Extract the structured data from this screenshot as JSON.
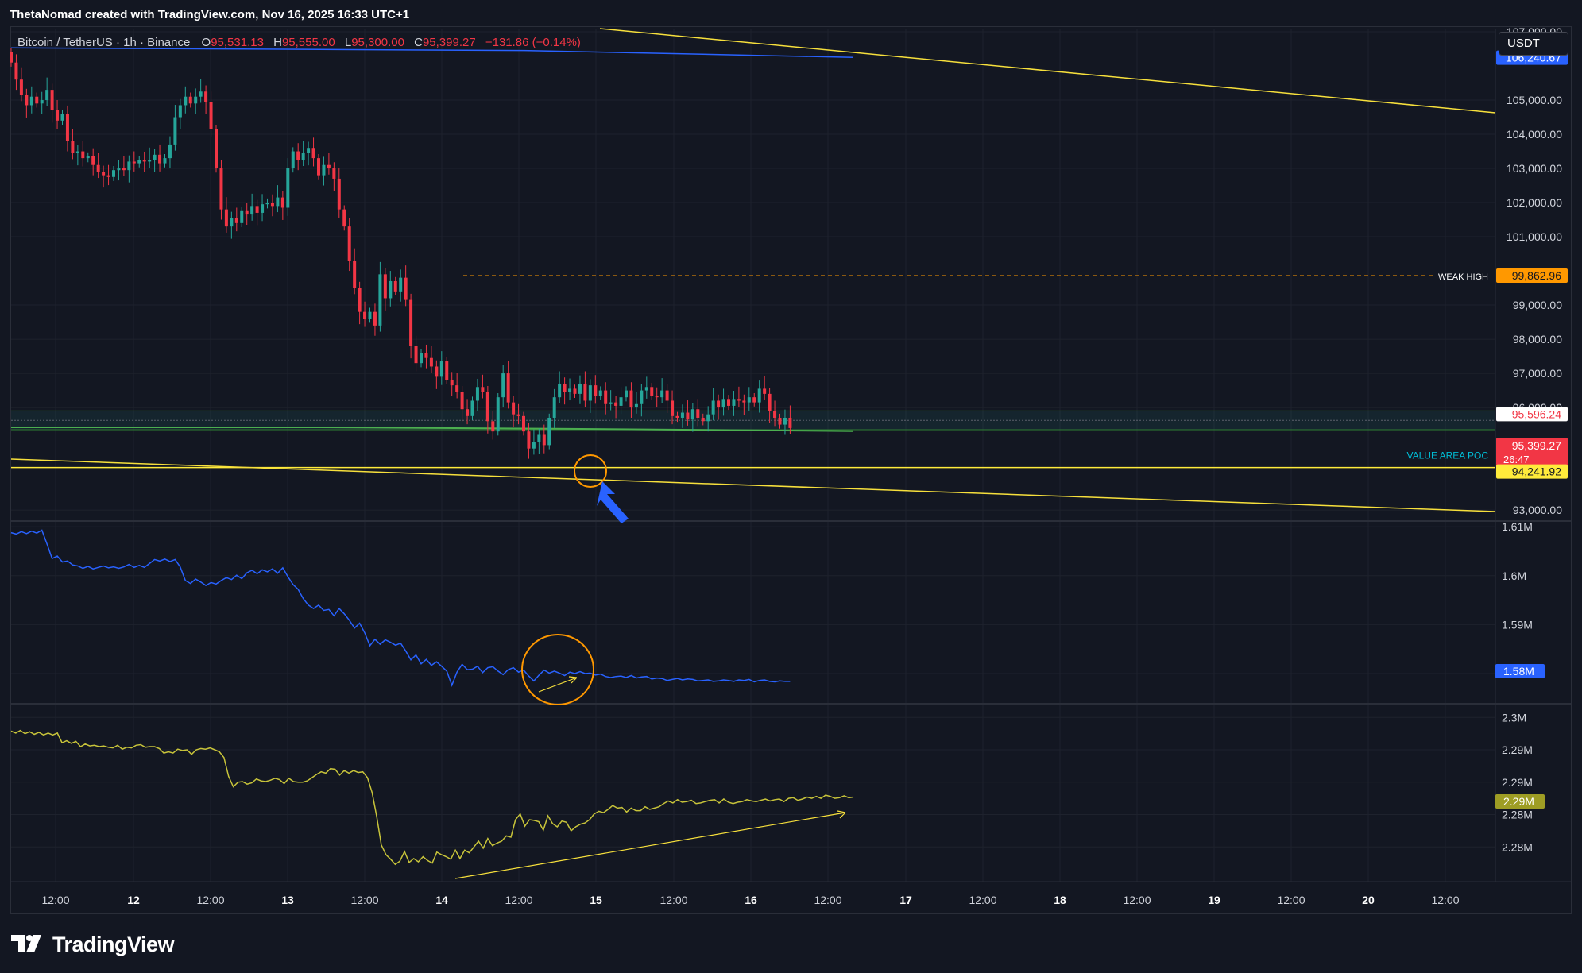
{
  "header": {
    "attribution": "ThetaNomad created with TradingView.com, Nov 16, 2025 16:33 UTC+1"
  },
  "symbol": {
    "name": "Bitcoin / TetherUS · 1h · Binance",
    "open_key": "O",
    "open": "95,531.13",
    "high_key": "H",
    "high": "95,555.00",
    "low_key": "L",
    "low": "95,300.00",
    "close_key": "C",
    "close": "95,399.27",
    "change": "−131.86 (−0.14%)"
  },
  "currency": "USDT",
  "logo": {
    "text": "TradingView"
  },
  "colors": {
    "background": "#131722",
    "grid": "#1e222d",
    "up": "#26a69a",
    "down": "#f23645",
    "trendline": "#f7e03c",
    "blue_line": "#2962ff",
    "weak_high": "#ff9800",
    "poc": "#ffeb3b",
    "cvd": "#2962ff",
    "obv": "#c8c43a",
    "annotation_orange": "#ff9800",
    "arrow_blue": "#2962ff"
  },
  "chart_data": [
    {
      "type": "candlestick",
      "pane": "price",
      "ylim": [
        92700,
        107000
      ],
      "y_ticks": [
        "107,000.00",
        "105,000.00",
        "104,000.00",
        "103,000.00",
        "102,000.00",
        "101,000.00",
        "99,000.00",
        "98,000.00",
        "97,000.00",
        "96,000.00",
        "93,000.00"
      ],
      "x_ticks": [
        "12:00",
        "12",
        "12:00",
        "13",
        "12:00",
        "14",
        "12:00",
        "15",
        "12:00",
        "16",
        "12:00",
        "17",
        "12:00",
        "18",
        "12:00",
        "19",
        "12:00",
        "20",
        "12:00"
      ],
      "close": [
        106100,
        105600,
        105150,
        104850,
        105100,
        104900,
        105000,
        105300,
        104700,
        104400,
        104600,
        103800,
        103450,
        103500,
        103300,
        103350,
        103100,
        102900,
        102800,
        102750,
        102950,
        103000,
        102950,
        103200,
        103150,
        103250,
        103200,
        103250,
        103400,
        103150,
        103300,
        103700,
        104500,
        104850,
        105100,
        104900,
        105100,
        105250,
        104950,
        104150,
        103000,
        101800,
        101300,
        101550,
        101400,
        101750,
        101650,
        101900,
        101700,
        101950,
        102000,
        101900,
        102150,
        101850,
        103000,
        103500,
        103250,
        103450,
        103600,
        103300,
        102800,
        103100,
        103000,
        102700,
        101800,
        101300,
        100300,
        99500,
        98800,
        98600,
        98800,
        98400,
        99900,
        99200,
        99700,
        99400,
        99800,
        99150,
        97800,
        97300,
        97600,
        97450,
        97200,
        96900,
        97350,
        96800,
        96650,
        96450,
        95950,
        95750,
        96200,
        96600,
        96450,
        95600,
        95300,
        96300,
        97000,
        96150,
        95800,
        95750,
        95300,
        94800,
        95000,
        95200,
        94900,
        95700,
        96300,
        96700,
        96450,
        96550,
        96400,
        96700,
        96200,
        96650,
        96350,
        96500,
        96100,
        96150,
        96050,
        96300,
        96500,
        96000,
        96100,
        96500,
        96600,
        96350,
        96300,
        96500,
        96200,
        95750,
        95700,
        95850,
        95650,
        95950,
        95700,
        95600,
        95800,
        96200,
        96000,
        96250,
        96050,
        96250,
        96200,
        96150,
        96300,
        96150,
        96550,
        96400,
        95900,
        95700,
        95500,
        95700,
        95399.27
      ],
      "indicators": {
        "value_area_poc_label": "VALUE AREA POC",
        "value_area_poc_price": "94,241.92",
        "weak_high_label": "WEAK HIGH",
        "weak_high_price": "99,862.96",
        "blue_line_price": "106,240.67",
        "band_top_price": "95,596.24",
        "last_price": "95,399.27",
        "countdown": "26:47",
        "band_low": 95350,
        "band_high": 95900
      }
    },
    {
      "type": "line",
      "pane": "cvd",
      "ylim": [
        1574000,
        1611000
      ],
      "y_ticks": [
        "1.61M",
        "1.6M",
        "1.59M",
        "1.58M"
      ],
      "last_label": "1.58M",
      "values": [
        1608800,
        1608500,
        1609000,
        1608600,
        1609100,
        1608700,
        1609300,
        1606500,
        1603500,
        1604000,
        1602800,
        1603000,
        1602200,
        1602000,
        1601500,
        1601900,
        1601400,
        1601700,
        1602000,
        1601600,
        1601800,
        1601500,
        1601800,
        1602300,
        1601700,
        1602100,
        1601700,
        1602500,
        1603300,
        1603000,
        1603400,
        1602900,
        1603300,
        1601800,
        1599000,
        1598400,
        1599300,
        1598700,
        1598000,
        1598600,
        1598300,
        1599000,
        1599600,
        1599200,
        1600100,
        1599400,
        1600600,
        1601100,
        1600400,
        1601200,
        1600800,
        1601400,
        1600500,
        1601600,
        1599800,
        1598200,
        1597200,
        1595300,
        1594000,
        1593300,
        1594000,
        1592900,
        1593100,
        1591800,
        1593300,
        1592200,
        1590900,
        1589300,
        1590300,
        1588300,
        1585700,
        1587000,
        1586000,
        1586900,
        1586400,
        1585800,
        1586200,
        1584600,
        1582800,
        1583800,
        1582000,
        1582900,
        1581700,
        1582400,
        1581500,
        1580500,
        1577600,
        1580300,
        1581900,
        1580800,
        1580900,
        1581500,
        1580200,
        1581200,
        1581400,
        1580500,
        1579800,
        1580800,
        1581200,
        1580300,
        1580700,
        1579500,
        1578500,
        1579700,
        1580700,
        1580100,
        1580500,
        1580100,
        1579600,
        1580300,
        1580000,
        1580400,
        1580000,
        1580100,
        1579700,
        1579900,
        1579400,
        1579200,
        1579400,
        1579500,
        1579200,
        1579600,
        1579100,
        1579300,
        1579400,
        1578900,
        1579100,
        1579000,
        1578600,
        1578800,
        1579000,
        1578700,
        1578900,
        1578800,
        1578500,
        1578600,
        1578700,
        1578400,
        1578500,
        1578700,
        1578600,
        1578400,
        1578700,
        1578600,
        1578800,
        1578300,
        1578600,
        1578700,
        1578400,
        1578300,
        1578500,
        1578400,
        1578400
      ]
    },
    {
      "type": "line",
      "pane": "obv",
      "ylim": [
        2275000,
        2302000
      ],
      "y_ticks": [
        "2.3M",
        "2.29M",
        "2.29M",
        "2.28M",
        "2.28M"
      ],
      "last_label": "2.29M",
      "values": [
        2297900,
        2297600,
        2298000,
        2297500,
        2297800,
        2297400,
        2297700,
        2297300,
        2297600,
        2297300,
        2297600,
        2296100,
        2296400,
        2296000,
        2296300,
        2295500,
        2295900,
        2295600,
        2295700,
        2295500,
        2295600,
        2295400,
        2295300,
        2295700,
        2295100,
        2295400,
        2295300,
        2295700,
        2295800,
        2295400,
        2295500,
        2295500,
        2295200,
        2294500,
        2294700,
        2294500,
        2295100,
        2294900,
        2295000,
        2294300,
        2295000,
        2295200,
        2295100,
        2295300,
        2295000,
        2294700,
        2293800,
        2290900,
        2289300,
        2290000,
        2290100,
        2289700,
        2289900,
        2290500,
        2290200,
        2290100,
        2290300,
        2290600,
        2290400,
        2289800,
        2290600,
        2290100,
        2290000,
        2290000,
        2290200,
        2290700,
        2291200,
        2291600,
        2291400,
        2292100,
        2292000,
        2291100,
        2291800,
        2291400,
        2291800,
        2291500,
        2291600,
        2290700,
        2288400,
        2284700,
        2280300,
        2278800,
        2278100,
        2277300,
        2277800,
        2279300,
        2277600,
        2278200,
        2277700,
        2278500,
        2277900,
        2277500,
        2279200,
        2278800,
        2278500,
        2278100,
        2279500,
        2278200,
        2279500,
        2279100,
        2280000,
        2280900,
        2279800,
        2281300,
        2280200,
        2280600,
        2280900,
        2281700,
        2281500,
        2284200,
        2285100,
        2283200,
        2284200,
        2284100,
        2283900,
        2282600,
        2284800,
        2283600,
        2283100,
        2284000,
        2283800,
        2282500,
        2283100,
        2283500,
        2283700,
        2284200,
        2285100,
        2285500,
        2285300,
        2285800,
        2286400,
        2286000,
        2286100,
        2285400,
        2286000,
        2285600,
        2285600,
        2286200,
        2285800,
        2286000,
        2286200,
        2286700,
        2287100,
        2286800,
        2287300,
        2286900,
        2287000,
        2287200,
        2286700,
        2286800,
        2287000,
        2287200,
        2287300,
        2286800,
        2287400,
        2286900,
        2286700,
        2286900,
        2287000,
        2287300,
        2287100,
        2287000,
        2287200,
        2287400,
        2287100,
        2287300,
        2287400,
        2287000,
        2287500,
        2287600,
        2287200,
        2287400,
        2287700,
        2287500,
        2287800,
        2287500,
        2288000,
        2287800,
        2287500,
        2287600,
        2287900,
        2287600,
        2287700
      ]
    }
  ]
}
